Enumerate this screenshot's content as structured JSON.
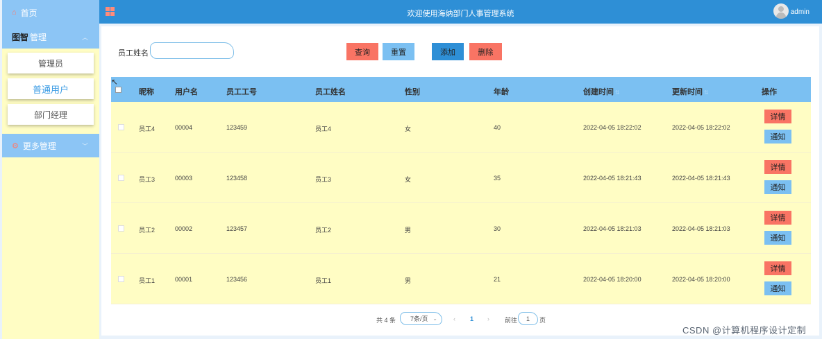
{
  "topbar": {
    "title": "欢迎使用海纳部门人事管理系统",
    "user": "admin",
    "menu_icon": "grid-icon",
    "avatar_icon": "user-avatar-icon"
  },
  "sidebar": {
    "home_label": "首页",
    "home_icon": "home-icon",
    "group1_overlay": "图智",
    "group1_label": "管理",
    "submenu": [
      "管理员",
      "普通用户",
      "部门经理"
    ],
    "group2_label": "更多管理"
  },
  "search": {
    "label": "员工姓名",
    "value": "",
    "placeholder": ""
  },
  "toolbar": {
    "query": "查询",
    "reset": "重置",
    "add": "添加",
    "delete": "删除"
  },
  "table": {
    "headers": {
      "nickname": "昵称",
      "username": "用户名",
      "emp_no": "员工工号",
      "emp_name": "员工姓名",
      "gender": "性别",
      "age": "年龄",
      "created": "创建时间",
      "updated": "更新时间",
      "actions": "操作"
    },
    "rows": [
      {
        "nickname": "员工4",
        "username": "00004",
        "emp_no": "123459",
        "emp_name": "员工4",
        "gender": "女",
        "age": "40",
        "created": "2022-04-05 18:22:02",
        "updated": "2022-04-05 18:22:02"
      },
      {
        "nickname": "员工3",
        "username": "00003",
        "emp_no": "123458",
        "emp_name": "员工3",
        "gender": "女",
        "age": "35",
        "created": "2022-04-05 18:21:43",
        "updated": "2022-04-05 18:21:43"
      },
      {
        "nickname": "员工2",
        "username": "00002",
        "emp_no": "123457",
        "emp_name": "员工2",
        "gender": "男",
        "age": "30",
        "created": "2022-04-05 18:21:03",
        "updated": "2022-04-05 18:21:03"
      },
      {
        "nickname": "员工1",
        "username": "00001",
        "emp_no": "123456",
        "emp_name": "员工1",
        "gender": "男",
        "age": "21",
        "created": "2022-04-05 18:20:00",
        "updated": "2022-04-05 18:20:00"
      }
    ],
    "detail_label": "详情",
    "notify_label": "通知"
  },
  "pagination": {
    "total": "共 4 条",
    "page_size": "7条/页",
    "prev": "‹",
    "current": "1",
    "next": "›",
    "goto_prefix": "前往",
    "goto_value": "1",
    "goto_suffix": "页"
  },
  "watermark": "CSDN @计算机程序设计定制",
  "colors": {
    "topbar": "#2e8fd6",
    "sidebar": "#fffdc4",
    "header": "#7bc0f2",
    "danger": "#f97464",
    "primary": "#2e8fd6",
    "light_primary": "#7bc0f2"
  }
}
